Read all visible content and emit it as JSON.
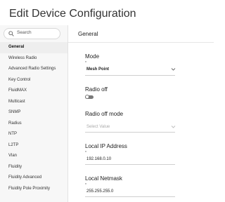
{
  "page": {
    "title": "Edit Device Configuration"
  },
  "search": {
    "placeholder": "Search"
  },
  "sidebar": {
    "items": [
      {
        "label": "General",
        "active": true
      },
      {
        "label": "Wireless Radio"
      },
      {
        "label": "Advanced Radio Settings"
      },
      {
        "label": "Key Control"
      },
      {
        "label": "FluidMAX"
      },
      {
        "label": "Multicast"
      },
      {
        "label": "SNMP"
      },
      {
        "label": "Radius"
      },
      {
        "label": "NTP"
      },
      {
        "label": "L2TP"
      },
      {
        "label": "Vlan"
      },
      {
        "label": "Fluidity"
      },
      {
        "label": "Fluidity Advanced"
      },
      {
        "label": "Fluidity Pole Proximity"
      }
    ]
  },
  "main": {
    "section_title": "General",
    "fields": {
      "mode": {
        "label": "Mode",
        "required_mark": "*",
        "value": "Mesh Point"
      },
      "radio_off": {
        "label": "Radio off",
        "on": false
      },
      "radio_off_mode": {
        "label": "Radio off mode",
        "placeholder": "Select Value"
      },
      "local_ip": {
        "label": "Local IP Address",
        "required_mark": "*",
        "value": "192.168.0.10"
      },
      "local_netmask": {
        "label": "Local Netmask",
        "required_mark": "*",
        "value": "255.255.255.0"
      }
    }
  }
}
